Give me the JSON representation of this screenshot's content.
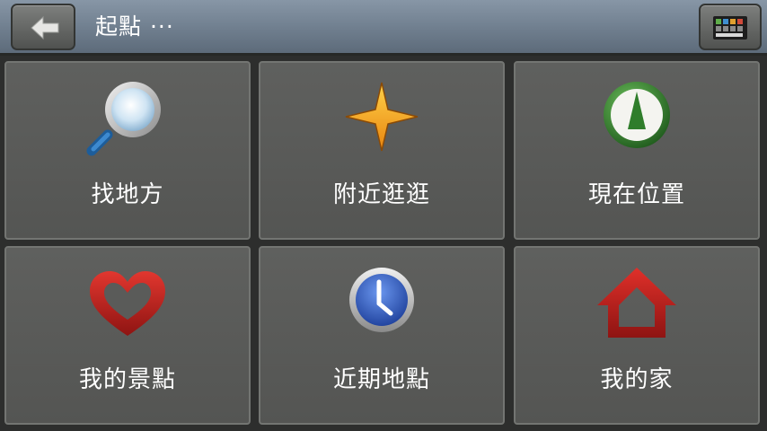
{
  "header": {
    "title": "起點 ···",
    "back_icon": "back-arrow-icon",
    "menu_icon": "color-palette-menu-icon"
  },
  "tiles": [
    {
      "label": "找地方",
      "icon": "magnifier-search-icon"
    },
    {
      "label": "附近逛逛",
      "icon": "compass-star-icon"
    },
    {
      "label": "現在位置",
      "icon": "current-position-icon"
    },
    {
      "label": "我的景點",
      "icon": "heart-favorites-icon"
    },
    {
      "label": "近期地點",
      "icon": "clock-recent-icon"
    },
    {
      "label": "我的家",
      "icon": "home-icon"
    }
  ],
  "colors": {
    "header_top": "#8796a6",
    "tile_bg": "#5a5b59",
    "star": "#f7a21a",
    "heart": "#c8201f",
    "home": "#c8201f",
    "position_green": "#2f7d2b",
    "clock_blue": "#2f5fc8"
  }
}
